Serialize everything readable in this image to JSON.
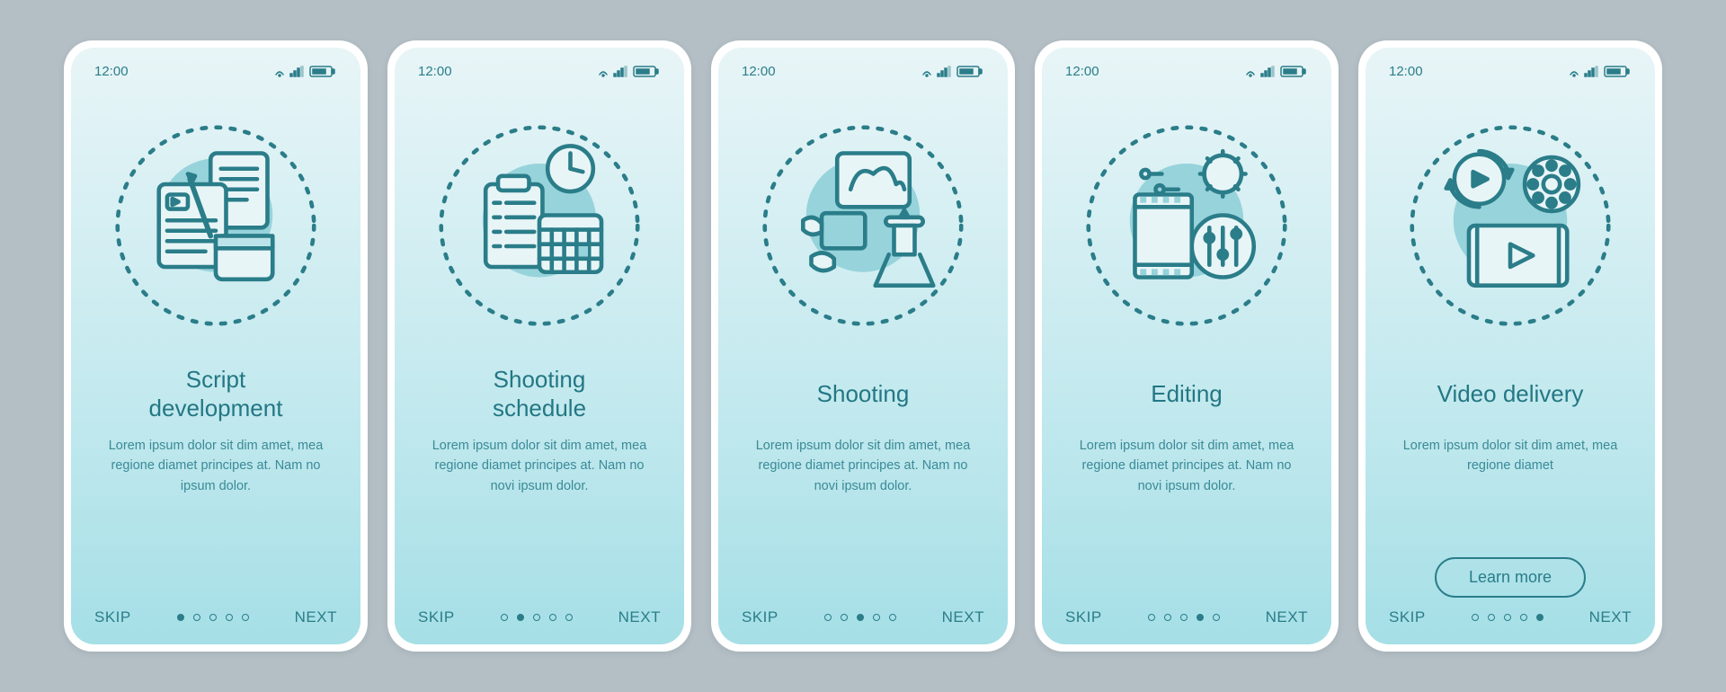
{
  "statusbar": {
    "time": "12:00"
  },
  "footer": {
    "skip": "SKIP",
    "next": "NEXT",
    "total_dots": 5
  },
  "learn_more_label": "Learn more",
  "screens": [
    {
      "title": "Script\ndevelopment",
      "desc": "Lorem ipsum dolor sit dim amet, mea regione diamet principes at. Nam no ipsum dolor.",
      "active_dot": 0,
      "has_button": false,
      "icon": "script-icon"
    },
    {
      "title": "Shooting\nschedule",
      "desc": "Lorem ipsum dolor sit dim amet, mea regione diamet principes at. Nam no novi ipsum dolor.",
      "active_dot": 1,
      "has_button": false,
      "icon": "schedule-icon"
    },
    {
      "title": "Shooting",
      "desc": "Lorem ipsum dolor sit dim amet, mea regione diamet principes at. Nam no novi ipsum dolor.",
      "active_dot": 2,
      "has_button": false,
      "icon": "shooting-icon"
    },
    {
      "title": "Editing",
      "desc": "Lorem ipsum dolor sit dim amet, mea regione diamet principes at. Nam no novi ipsum dolor.",
      "active_dot": 3,
      "has_button": false,
      "icon": "editing-icon"
    },
    {
      "title": "Video delivery",
      "desc": "Lorem ipsum dolor sit dim amet, mea regione diamet",
      "active_dot": 4,
      "has_button": true,
      "icon": "delivery-icon"
    }
  ]
}
